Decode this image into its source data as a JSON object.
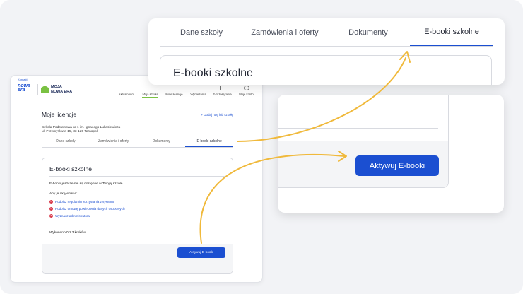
{
  "top_link": "Kontakt",
  "logo": {
    "brand_line1": "nowa",
    "brand_line2": "era",
    "name_line1": "MOJA",
    "name_line2": "NOWA ERA"
  },
  "nav": [
    {
      "label": "Aktualności",
      "icon": "news-icon"
    },
    {
      "label": "Moja szkoła",
      "icon": "school-icon"
    },
    {
      "label": "Moje licencje",
      "icon": "license-icon"
    },
    {
      "label": "Wydarzenia",
      "icon": "calendar-icon"
    },
    {
      "label": "E-rozwiązania",
      "icon": "grid-icon"
    },
    {
      "label": "Moje konto",
      "icon": "user-icon"
    }
  ],
  "page_title": "Moje licencje",
  "add_role_link": "+ Dodaj rolę lub szkołę",
  "school": {
    "name": "Szkoła Podstawowa nr 1 im. Ignacego Łukasiewicza",
    "address": "ul. Przemysłowa 15, 33-120 Tarnopol"
  },
  "tabs": [
    "Dane szkoły",
    "Zamówienia i oferty",
    "Dokumenty",
    "E-booki szkolne"
  ],
  "card": {
    "title": "E-booki szkolne",
    "info": "E-booki jeszcze nie są dostępne w Twojej szkole.",
    "prompt": "Aby je aktywować:",
    "requirements": [
      "Podpisz regulamin korzystania z systemu",
      "Podpisz umowę powierzenia danych osobowych",
      "Wyznacz administratora"
    ],
    "steps": "Wykonano 0 z 3 kroków",
    "button": "Aktywuj E-booki"
  },
  "zoom_top": {
    "tabs": [
      "Dane szkoły",
      "Zamówienia i oferty",
      "Dokumenty",
      "E-booki szkolne"
    ],
    "title": "E-booki szkolne"
  },
  "zoom_bottom": {
    "button": "Aktywuj E-booki"
  },
  "colors": {
    "accent": "#1b4fd1",
    "arrow": "#f0b93b",
    "brand_green": "#7ac142",
    "error": "#d83a4a"
  }
}
